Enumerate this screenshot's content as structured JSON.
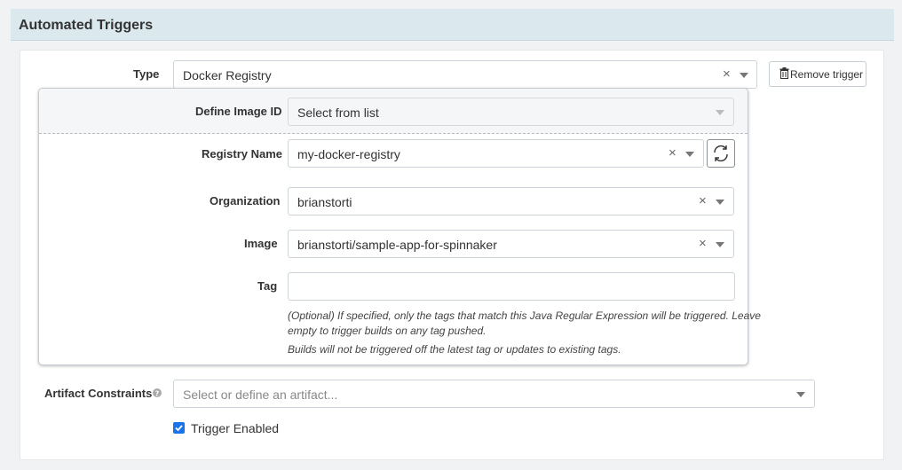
{
  "section": {
    "title": "Automated Triggers"
  },
  "type_row": {
    "label": "Type",
    "value": "Docker Registry",
    "clear_glyph": "×",
    "remove_button_label": "Remove trigger",
    "remove_icon": "trash-icon"
  },
  "define_image": {
    "label": "Define Image ID",
    "value": "Select from list"
  },
  "registry": {
    "label": "Registry Name",
    "value": "my-docker-registry",
    "clear_glyph": "×",
    "refresh_icon": "refresh-icon"
  },
  "organization": {
    "label": "Organization",
    "value": "brianstorti",
    "clear_glyph": "×"
  },
  "image": {
    "label": "Image",
    "value": "brianstorti/sample-app-for-spinnaker",
    "clear_glyph": "×"
  },
  "tag": {
    "label": "Tag",
    "value": "",
    "help_1": "(Optional) If specified, only the tags that match this Java Regular Expression will be triggered. Leave",
    "help_2": "empty to trigger builds on any tag pushed.",
    "help_3": "Builds will not be triggered off the latest tag or updates to existing tags."
  },
  "artifacts": {
    "label": "Artifact Constraints",
    "help_icon": "question-circle-icon",
    "placeholder": "Select or define an artifact..."
  },
  "enabled": {
    "label": "Trigger Enabled",
    "checked": true
  },
  "colors": {
    "header_bg": "#dbe9ef",
    "checkbox": "#1a73e8"
  }
}
